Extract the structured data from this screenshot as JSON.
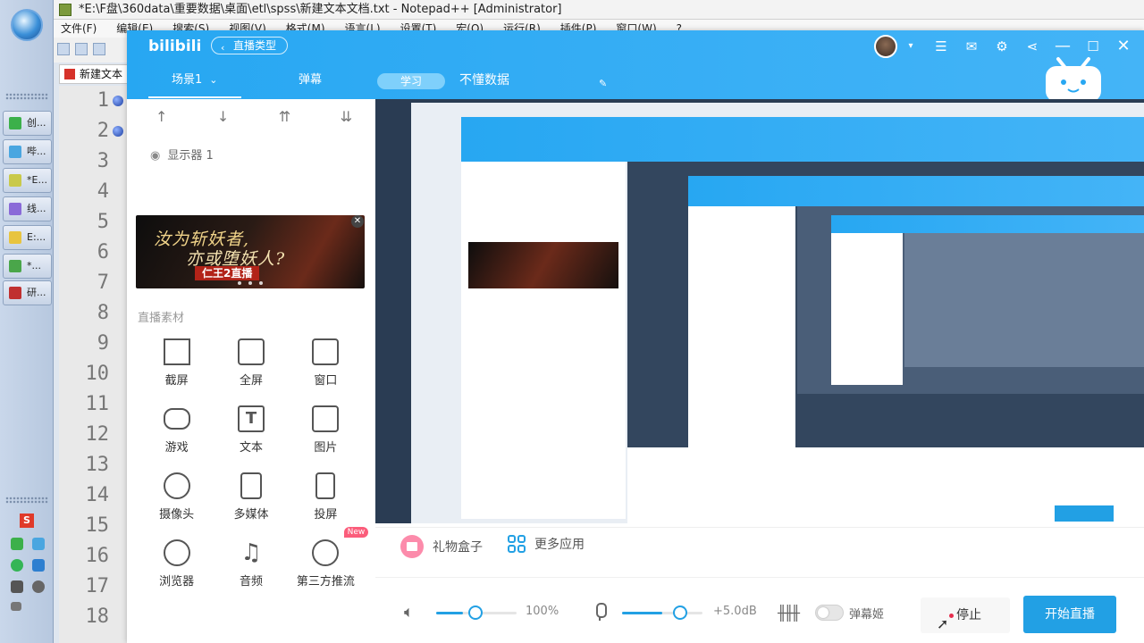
{
  "notepad": {
    "title": "*E:\\F盘\\360data\\重要数据\\桌面\\etl\\spss\\新建文本文档.txt - Notepad++ [Administrator]",
    "menu": [
      "文件(F)",
      "编辑(E)",
      "搜索(S)",
      "视图(V)",
      "格式(M)",
      "语言(L)",
      "设置(T)",
      "宏(O)",
      "运行(R)",
      "插件(P)",
      "窗口(W)",
      "?"
    ],
    "tab_label": "新建文本",
    "line_numbers": [
      "1",
      "2",
      "3",
      "4",
      "5",
      "6",
      "7",
      "8",
      "9",
      "10",
      "11",
      "12",
      "13",
      "14",
      "15",
      "16",
      "17",
      "18"
    ]
  },
  "taskbar": {
    "items": [
      {
        "label": "创...",
        "color": "#3cb04a"
      },
      {
        "label": "哔...",
        "color": "#4aa6e0"
      },
      {
        "label": "*E...",
        "color": "#c9c94a"
      },
      {
        "label": "线...",
        "color": "#8a6ad8"
      },
      {
        "label": "E:...",
        "color": "#e8c440"
      },
      {
        "label": "*...",
        "color": "#4aa64a"
      },
      {
        "label": "研...",
        "color": "#c03030"
      }
    ],
    "tray_s": "S"
  },
  "bili": {
    "logo": "bilibili",
    "live_type_button": "直播类型",
    "tabs": {
      "scene": "场景1",
      "danmu": "弹幕",
      "study": "学习",
      "data": "不懂数据"
    },
    "monitor": "显示器 1",
    "banner": {
      "line1": "汝为斩妖者,",
      "line2": "亦或堕妖人?",
      "line3": "仁王2直播"
    },
    "section_title": "直播素材",
    "tools": [
      {
        "label": "截屏",
        "icon": "crop-icon"
      },
      {
        "label": "全屏",
        "icon": "monitor-icon"
      },
      {
        "label": "窗口",
        "icon": "window-icon"
      },
      {
        "label": "游戏",
        "icon": "gamepad-icon"
      },
      {
        "label": "文本",
        "icon": "text-icon",
        "glyph": "T"
      },
      {
        "label": "图片",
        "icon": "image-icon"
      },
      {
        "label": "摄像头",
        "icon": "camera-icon"
      },
      {
        "label": "多媒体",
        "icon": "media-icon"
      },
      {
        "label": "投屏",
        "icon": "phone-icon"
      },
      {
        "label": "浏览器",
        "icon": "browser-icon"
      },
      {
        "label": "音频",
        "icon": "music-icon"
      },
      {
        "label": "第三方推流",
        "icon": "stream-icon",
        "badge": "New"
      }
    ],
    "gift_box": "礼物盒子",
    "more_apps": "更多应用",
    "volume": {
      "value": "100%",
      "level": 0.33
    },
    "mic": {
      "value": "+5.0dB",
      "level": 0.5
    },
    "danmaku_toggle": "弹幕姬",
    "stop": "停止",
    "start": "开始直播",
    "colors": {
      "brand_blue": "#22a0e4",
      "header_blue": "#27a7f2",
      "badge_pink": "#fb5d7b"
    }
  }
}
